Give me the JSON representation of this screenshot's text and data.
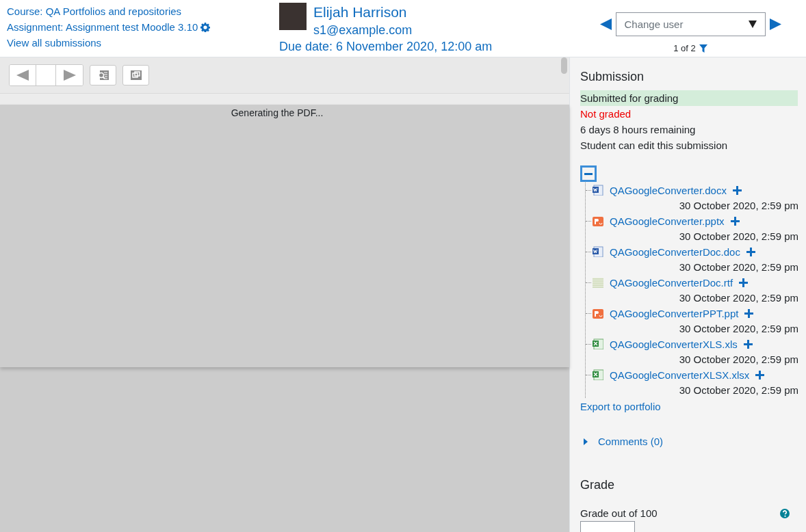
{
  "header": {
    "course_link": "Course: QA Portfolios and repositories",
    "assignment_link": "Assignment: Assignment test Moodle 3.10",
    "view_all_link": "View all submissions",
    "user_name": "Elijah Harrison",
    "user_email": "s1@example.com",
    "due_date": "Due date: 6 November 2020, 12:00 am",
    "change_user": {
      "placeholder": "Change user"
    },
    "user_count": "1 of 2"
  },
  "viewer": {
    "message": "Generating the PDF..."
  },
  "submission": {
    "title": "Submission",
    "statuses": [
      {
        "text": "Submitted for grading",
        "kind": "success"
      },
      {
        "text": "Not graded",
        "kind": "danger"
      },
      {
        "text": "6 days 8 hours remaining",
        "kind": "plain"
      },
      {
        "text": "Student can edit this submission",
        "kind": "plain"
      }
    ],
    "files_expanded": true,
    "files": [
      {
        "name": "QAGoogleConverter.docx",
        "kind": "word",
        "date": "30 October 2020, 2:59 pm"
      },
      {
        "name": "QAGoogleConverter.pptx",
        "kind": "powerpoint",
        "date": "30 October 2020, 2:59 pm"
      },
      {
        "name": "QAGoogleConverterDoc.doc",
        "kind": "word",
        "date": "30 October 2020, 2:59 pm"
      },
      {
        "name": "QAGoogleConverterDoc.rtf",
        "kind": "text",
        "date": "30 October 2020, 2:59 pm"
      },
      {
        "name": "QAGoogleConverterPPT.ppt",
        "kind": "powerpoint",
        "date": "30 October 2020, 2:59 pm"
      },
      {
        "name": "QAGoogleConverterXLS.xls",
        "kind": "excel",
        "date": "30 October 2020, 2:59 pm"
      },
      {
        "name": "QAGoogleConverterXLSX.xlsx",
        "kind": "excel",
        "date": "30 October 2020, 2:59 pm"
      }
    ],
    "export_link": "Export to portfolio",
    "comments": {
      "label": "Comments (0)",
      "expanded": false
    }
  },
  "grade": {
    "title": "Grade",
    "label": "Grade out of 100"
  }
}
